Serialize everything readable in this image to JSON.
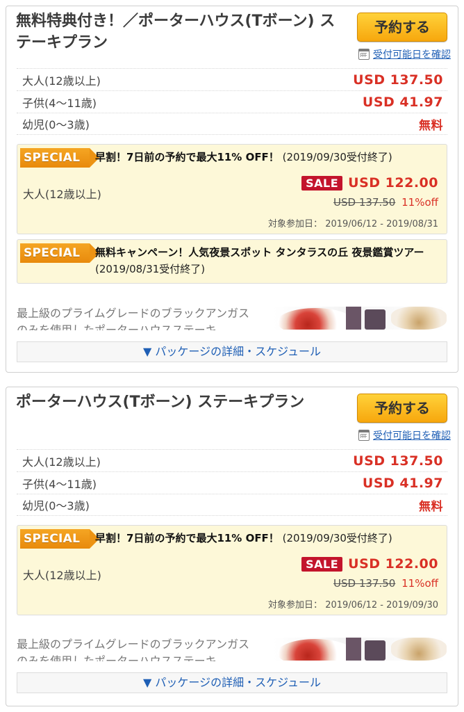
{
  "book_label": "予約する",
  "availability_label": "受付可能日を確認",
  "details_label": "▼ パッケージの詳細・スケジュール",
  "special_label": "SPECIAL",
  "sale_label": "SALE",
  "date_prefix": "対象参加日：",
  "description": "最上級のプライムグレードのブラックアンガスのみを使用したポーターハウスステーキ",
  "plans": [
    {
      "title": "無料特典付き！／ポーターハウス(Tボーン) ステーキプラン",
      "prices": [
        {
          "label": "大人(12歳以上)",
          "price": "USD 137.50"
        },
        {
          "label": "子供(4〜11歳)",
          "price": "USD 41.97"
        },
        {
          "label": "幼児(0〜3歳)",
          "price": "無料"
        }
      ],
      "promo": {
        "headline": "早割！7日前の予約で最大11% OFF！",
        "deadline": "(2019/09/30受付終了)",
        "adult_label": "大人(12歳以上)",
        "sale_price": "USD 122.00",
        "original_price": "USD 137.50",
        "discount": "11%off",
        "dates": "2019/06/12 - 2019/08/31"
      },
      "promo2": {
        "headline": "無料キャンペーン！人気夜景スポット タンタラスの丘 夜景鑑賞ツアー",
        "deadline": "(2019/08/31受付終了)"
      }
    },
    {
      "title": "ポーターハウス(Tボーン) ステーキプラン",
      "prices": [
        {
          "label": "大人(12歳以上)",
          "price": "USD 137.50"
        },
        {
          "label": "子供(4〜11歳)",
          "price": "USD 41.97"
        },
        {
          "label": "幼児(0〜3歳)",
          "price": "無料"
        }
      ],
      "promo": {
        "headline": "早割！7日前の予約で最大11% OFF！",
        "deadline": "(2019/09/30受付終了)",
        "adult_label": "大人(12歳以上)",
        "sale_price": "USD 122.00",
        "original_price": "USD 137.50",
        "discount": "11%off",
        "dates": "2019/06/12 - 2019/09/30"
      }
    }
  ],
  "colors": {
    "price_red": "#d93025",
    "link_blue": "#1f5fb5",
    "button_yellow": "#f7a70d",
    "special_orange": "#f5a623",
    "sale_red": "#c3142c",
    "promo_bg": "#fdf8d8"
  }
}
